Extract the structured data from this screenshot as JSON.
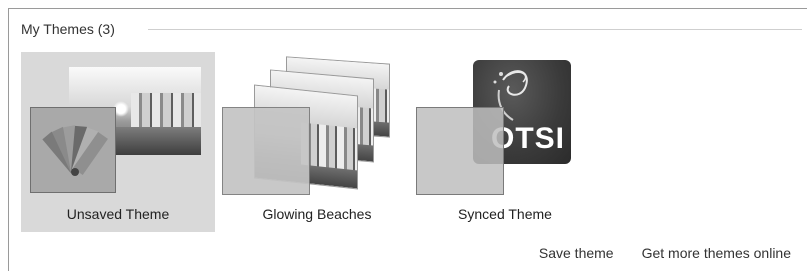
{
  "group": {
    "title": "My Themes (3)"
  },
  "themes": [
    {
      "label": "Unsaved Theme",
      "selected": true
    },
    {
      "label": "Glowing Beaches",
      "selected": false
    },
    {
      "label": "Synced Theme",
      "selected": false,
      "logo_text": "OTSI"
    }
  ],
  "links": {
    "save": "Save theme",
    "more": "Get more themes online"
  },
  "colors": {
    "selected_bg": "#d9d9d9",
    "logo_bg": "#3a3a3a"
  }
}
